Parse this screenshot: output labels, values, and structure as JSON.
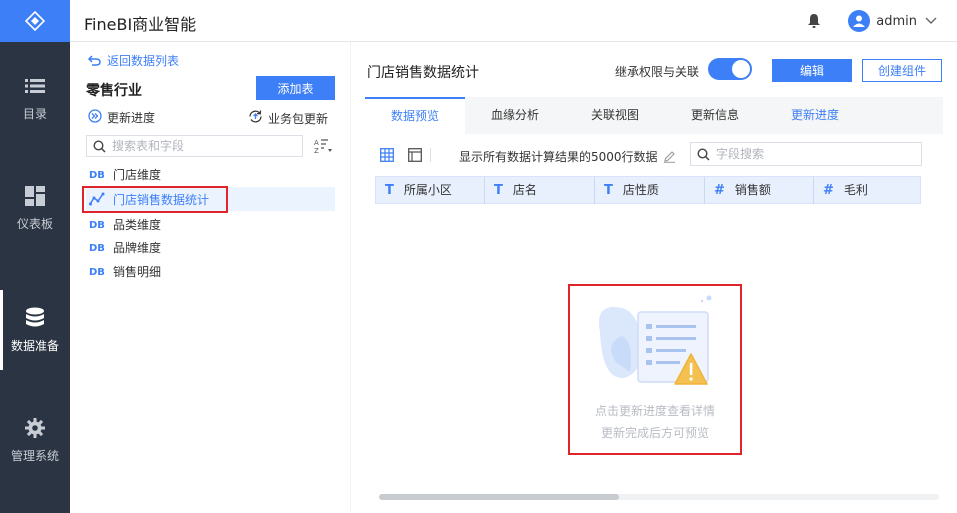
{
  "app": {
    "title": "FineBI商业智能"
  },
  "user": {
    "name": "admin"
  },
  "nav": {
    "items": [
      {
        "label": "目录",
        "icon": "list-icon"
      },
      {
        "label": "仪表板",
        "icon": "dashboard-icon"
      },
      {
        "label": "数据准备",
        "icon": "database-icon",
        "active": true
      },
      {
        "label": "管理系统",
        "icon": "gear-icon"
      }
    ]
  },
  "left": {
    "back_label": "返回数据列表",
    "group_title": "零售行业",
    "add_table_label": "添加表",
    "update_progress_label": "更新进度",
    "pkg_update_label": "业务包更新",
    "search_placeholder": "搜索表和字段",
    "tables": [
      {
        "label": "门店维度"
      },
      {
        "label": "门店销售数据统计",
        "selected": true
      },
      {
        "label": "品类维度"
      },
      {
        "label": "品牌维度"
      },
      {
        "label": "销售明细"
      }
    ]
  },
  "main": {
    "title": "门店销售数据统计",
    "inherit_label": "继承权限与关联",
    "edit_label": "编辑",
    "create_label": "创建组件",
    "tabs": [
      {
        "label": "数据预览",
        "active": true
      },
      {
        "label": "血缘分析"
      },
      {
        "label": "关联视图"
      },
      {
        "label": "更新信息"
      },
      {
        "label": "更新进度",
        "link": true
      }
    ],
    "row_info": "显示所有数据计算结果的5000行数据",
    "field_search_placeholder": "字段搜索",
    "columns": [
      {
        "type": "T",
        "label": "所属小区"
      },
      {
        "type": "T",
        "label": "店名"
      },
      {
        "type": "T",
        "label": "店性质"
      },
      {
        "type": "#",
        "label": "销售额"
      },
      {
        "type": "#",
        "label": "毛利"
      }
    ],
    "empty_line1": "点击更新进度查看详情",
    "empty_line2": "更新完成后方可预览"
  },
  "colors": {
    "accent": "#3d7ff6",
    "rail": "#2b3442",
    "highlight": "#e0242c"
  }
}
